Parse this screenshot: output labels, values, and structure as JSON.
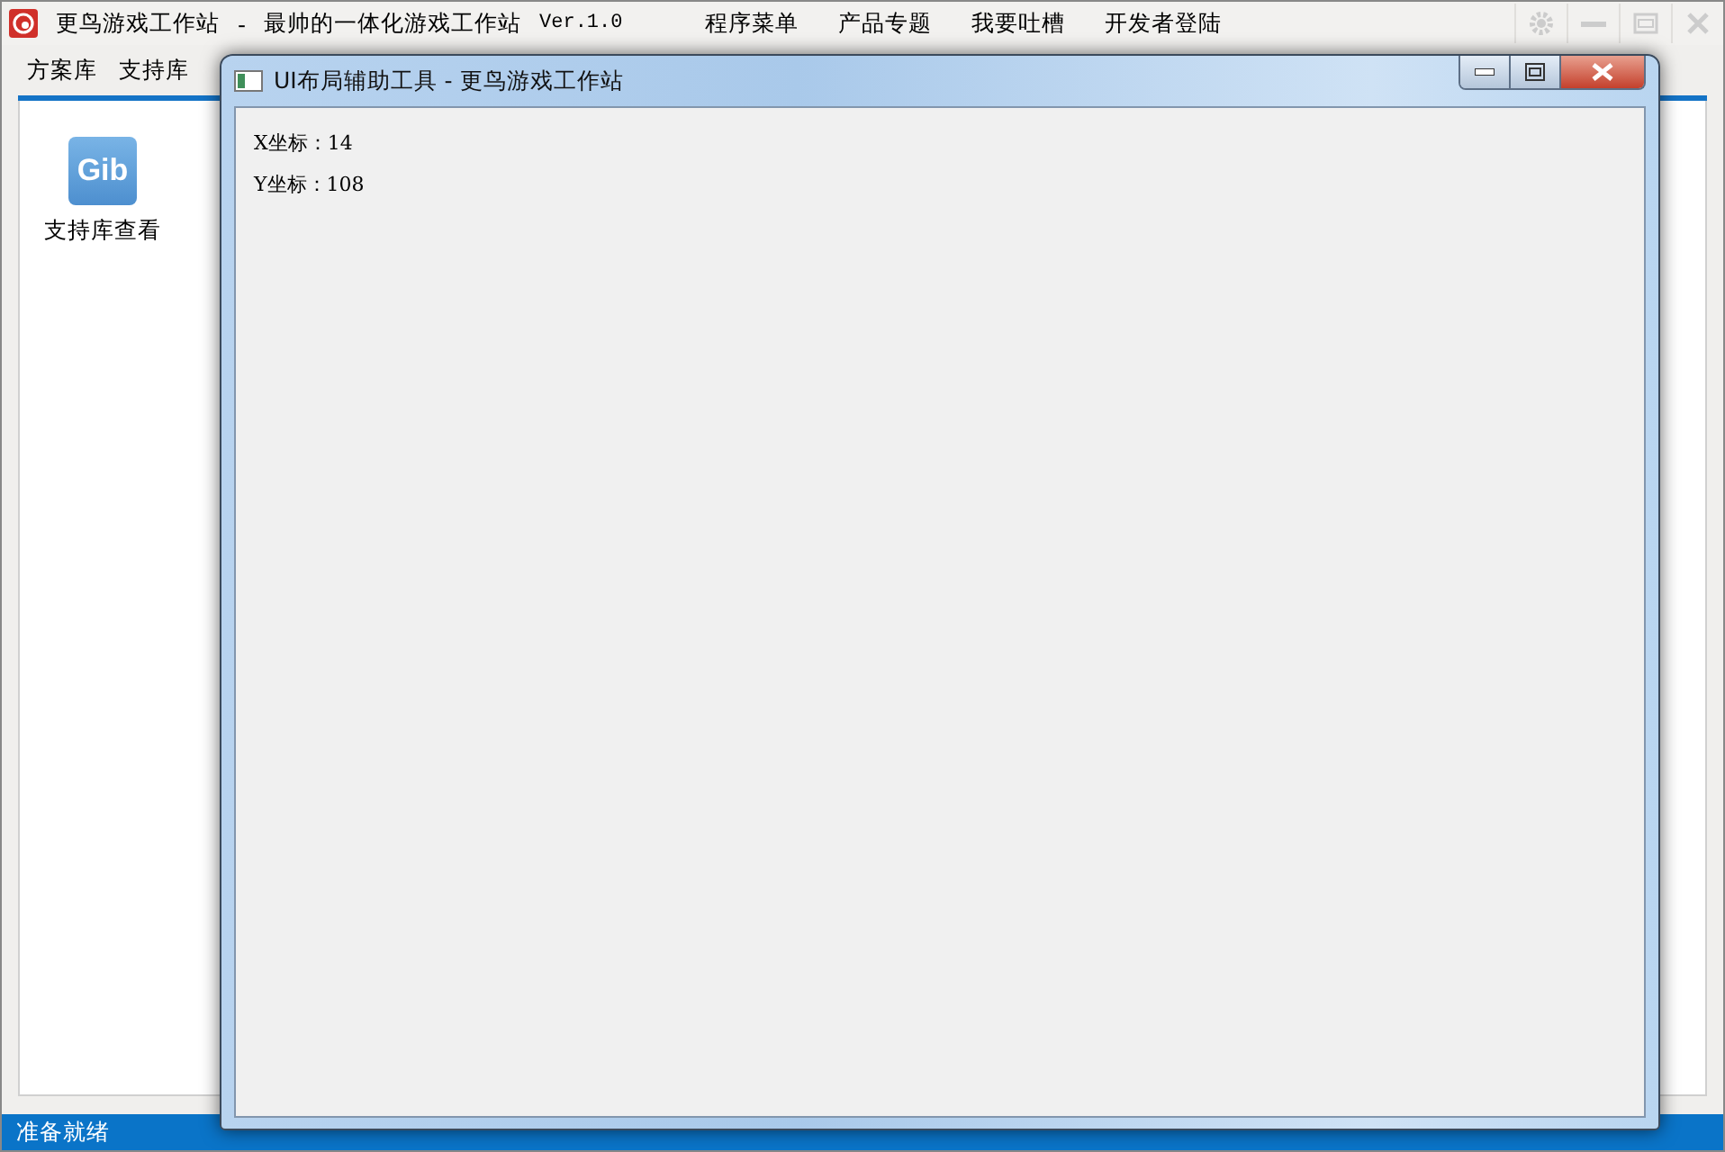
{
  "app": {
    "title": "更鸟游戏工作站",
    "separator": "-",
    "subtitle": "最帅的一体化游戏工作站",
    "version": "Ver.1.0",
    "menu": [
      "程序菜单",
      "产品专题",
      "我要吐槽",
      "开发者登陆"
    ]
  },
  "tabs": [
    {
      "label": "方案库"
    },
    {
      "label": "支持库"
    }
  ],
  "tools": [
    {
      "label": "支持库查看",
      "icon_text": "Gib"
    }
  ],
  "status_bar": {
    "text": "准备就绪"
  },
  "dialog": {
    "title": "UI布局辅助工具 - 更鸟游戏工作站",
    "lines": [
      "X坐标：14",
      "Y坐标：108"
    ]
  }
}
